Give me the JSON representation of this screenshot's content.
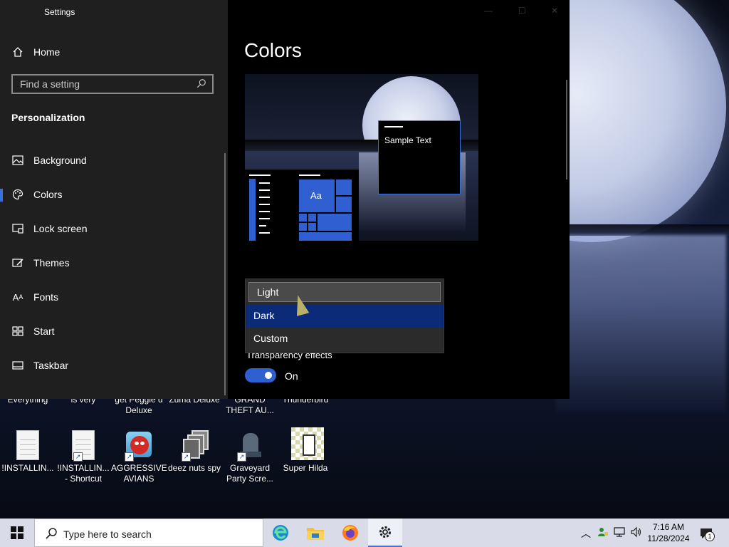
{
  "settings": {
    "app_title": "Settings",
    "home_label": "Home",
    "search_placeholder": "Find a setting",
    "section_title": "Personalization",
    "nav_items": [
      {
        "label": "Background",
        "icon": "image-icon"
      },
      {
        "label": "Colors",
        "icon": "palette-icon",
        "active": true
      },
      {
        "label": "Lock screen",
        "icon": "lock-screen-icon"
      },
      {
        "label": "Themes",
        "icon": "themes-icon"
      },
      {
        "label": "Fonts",
        "icon": "fonts-icon"
      },
      {
        "label": "Start",
        "icon": "start-icon"
      },
      {
        "label": "Taskbar",
        "icon": "taskbar-icon"
      }
    ],
    "page_title": "Colors",
    "preview": {
      "sample_text": "Sample Text",
      "tile_text": "Aa"
    },
    "mode_dropdown": {
      "options": [
        "Light",
        "Dark",
        "Custom"
      ],
      "highlighted": "Dark"
    },
    "transparency_label": "Transparency effects",
    "transparency_state": "On",
    "accent_color": "#2f5fd0"
  },
  "desktop": {
    "top_labels": [
      "Everything",
      "is very",
      "get Peggle d Deluxe",
      "Zuma Deluxe",
      "GRAND THEFT AU...",
      "Thunderbird"
    ],
    "icons": [
      {
        "name": "!INSTALLIN...",
        "icon": "document-icon"
      },
      {
        "name": "!INSTALLIN... - Shortcut",
        "icon": "document-shortcut-icon"
      },
      {
        "name": "AGGRESSIVE AVIANS",
        "icon": "angry-bird-icon"
      },
      {
        "name": "deez nuts spy",
        "icon": "stacked-windows-icon"
      },
      {
        "name": "Graveyard Party Scre...",
        "icon": "graveyard-icon"
      },
      {
        "name": "Super Hilda",
        "icon": "pixel-game-icon"
      }
    ]
  },
  "taskbar": {
    "search_placeholder": "Type here to search",
    "apps": [
      "edge-icon",
      "file-explorer-icon",
      "firefox-icon",
      "settings-gear-icon"
    ],
    "time": "7:16 AM",
    "date": "11/28/2024",
    "notification_count": "1"
  }
}
